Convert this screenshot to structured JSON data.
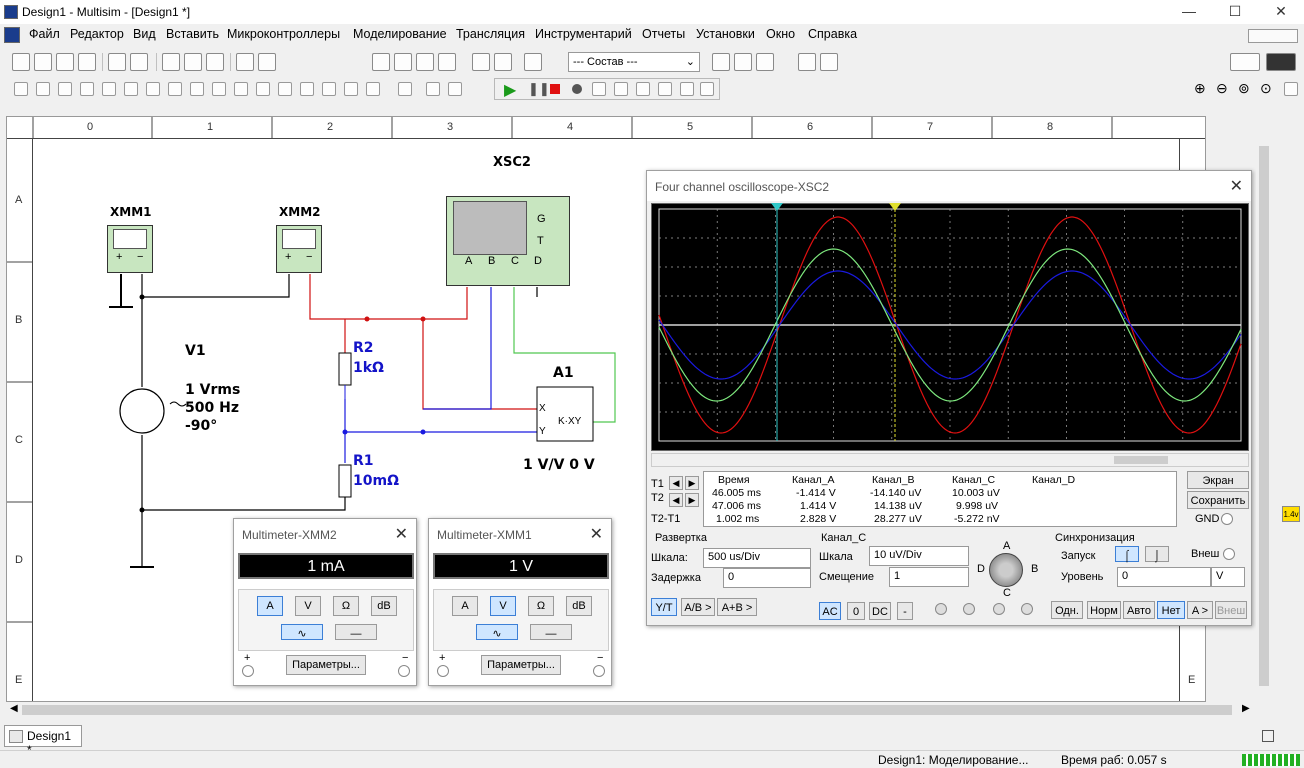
{
  "window": {
    "title": "Design1 - Multisim - [Design1 *]",
    "minimize": "—",
    "maximize": "☐",
    "close": "✕"
  },
  "menu": [
    "Файл",
    "Редактор",
    "Вид",
    "Вставить",
    "Микроконтроллеры",
    "Моделирование",
    "Трансляция",
    "Инструментарий",
    "Отчеты",
    "Установки",
    "Окно",
    "Справка"
  ],
  "toolbar": {
    "component_dropdown": "--- Состав ---"
  },
  "rulers": {
    "top": [
      "0",
      "1",
      "2",
      "3",
      "4",
      "5",
      "6",
      "7",
      "8"
    ],
    "left": [
      "A",
      "B",
      "C",
      "D",
      "E"
    ],
    "right": [
      "A",
      "B",
      "C",
      "D",
      "E"
    ]
  },
  "schematic": {
    "xmm1": "XMM1",
    "xmm2": "XMM2",
    "xsc2": "XSC2",
    "v1": {
      "name": "V1",
      "line1": "1 Vrms",
      "line2": "500 Hz",
      "line3": "-90°"
    },
    "r2": {
      "name": "R2",
      "value": "1kΩ"
    },
    "r1": {
      "name": "R1",
      "value": "10mΩ"
    },
    "a1": {
      "name": "A1",
      "value": "1 V/V 0 V",
      "inner": "K·XY",
      "x": "X",
      "y": "Y"
    },
    "osc_pins": [
      "A",
      "B",
      "C",
      "D"
    ],
    "osc_g": "G",
    "osc_t": "T",
    "mm_plus": "+",
    "mm_minus": "−"
  },
  "multimeter_xmm2": {
    "title": "Multimeter-XMM2",
    "display": "1 mA",
    "modes": [
      "A",
      "V",
      "Ω",
      "dB"
    ],
    "active_mode": "A",
    "params": "Параметры...",
    "plus": "+",
    "minus": "−"
  },
  "multimeter_xmm1": {
    "title": "Multimeter-XMM1",
    "display": "1 V",
    "modes": [
      "A",
      "V",
      "Ω",
      "dB"
    ],
    "active_mode": "V",
    "params": "Параметры...",
    "plus": "+",
    "minus": "−"
  },
  "oscilloscope": {
    "title": "Four channel oscilloscope-XSC2",
    "colors": {
      "A": "#e01010",
      "B": "#1a1ae0",
      "C": "#7ee87e",
      "cursor1": "#30c8c8",
      "cursor2": "#e0e030"
    },
    "table_headers": [
      "Время",
      "Канал_A",
      "Канал_B",
      "Канал_C",
      "Канал_D"
    ],
    "rows": [
      {
        "label": "T1",
        "time": "46.005 ms",
        "a": "-1.414 V",
        "b": "-14.140 uV",
        "c": "10.003 uV",
        "d": ""
      },
      {
        "label": "T2",
        "time": "47.006 ms",
        "a": "1.414 V",
        "b": "14.138 uV",
        "c": "9.998 uV",
        "d": ""
      },
      {
        "label": "T2-T1",
        "time": "1.002 ms",
        "a": "2.828 V",
        "b": "28.277 uV",
        "c": "-5.272 nV",
        "d": ""
      }
    ],
    "screen_btn": "Экран",
    "save_btn": "Сохранить",
    "gnd": "GND",
    "timebase": {
      "title": "Развертка",
      "scale_label": "Шкала:",
      "scale": "500 us/Div",
      "delay_label": "Задержка",
      "delay": "0",
      "yt": "Y/T",
      "ab": "A/B >",
      "apb": "A+B >"
    },
    "channel": {
      "title": "Канал_C",
      "scale_label": "Шкала",
      "scale": "10 uV/Div",
      "offset_label": "Смещение",
      "offset": "1",
      "ac": "AC",
      "zero": "0",
      "dc": "DC",
      "minus": "-",
      "knob": {
        "a": "A",
        "b": "B",
        "c": "C",
        "d": "D"
      }
    },
    "trigger": {
      "title": "Синхронизация",
      "start_label": "Запуск",
      "ext": "Внеш",
      "level_label": "Уровень",
      "level": "0",
      "unit": "V",
      "single": "Одн.",
      "normal": "Норм",
      "auto": "Авто",
      "none": "Нет",
      "a": "A >",
      "ext2": "Внеш"
    }
  },
  "tab": {
    "label": "Design1 *"
  },
  "status": {
    "sim": "Design1: Моделирование...",
    "time": "Время раб: 0.057 s"
  },
  "vgauge": "1.4v"
}
